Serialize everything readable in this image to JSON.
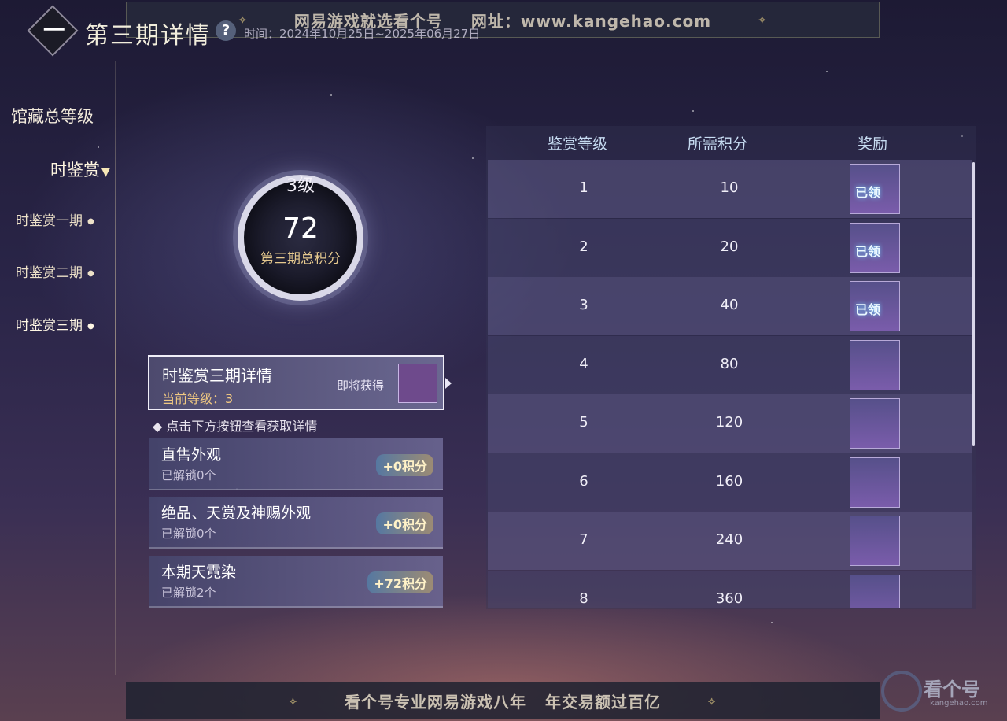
{
  "watermark": {
    "top_left": "网易游戏就选看个号",
    "top_right": "网址：www.kangehao.com",
    "bottom_left": "看个号专业网易游戏八年",
    "bottom_right": "年交易额过百亿"
  },
  "header": {
    "title": "第三期详情",
    "help_label": "?",
    "period": "时间：2024年10月25日~2025年06月27日"
  },
  "sidebar": {
    "total_level": "馆藏总等级",
    "main": "时鉴赏",
    "items": [
      {
        "label": "时鉴赏一期"
      },
      {
        "label": "时鉴赏二期"
      },
      {
        "label": "时鉴赏三期"
      }
    ]
  },
  "score": {
    "level": "3级",
    "points": "72",
    "label": "第三期总积分"
  },
  "detail_card": {
    "title": "时鉴赏三期详情",
    "current_level": "当前等级：3",
    "upcoming": "即将获得"
  },
  "hint": "◆ 点击下方按钮查看获取详情",
  "sources": [
    {
      "title": "直售外观",
      "unlocked": "已解锁0个",
      "points": "+0积分"
    },
    {
      "title": "绝品、天赏及神赐外观",
      "unlocked": "已解锁0个",
      "points": "+0积分"
    },
    {
      "title": "本期天霓染",
      "unlocked": "已解锁2个",
      "points": "+72积分"
    }
  ],
  "table": {
    "headers": [
      "鉴赏等级",
      "所需积分",
      "奖励"
    ],
    "rows": [
      {
        "level": "1",
        "points": "10",
        "claimed": "已领"
      },
      {
        "level": "2",
        "points": "20",
        "claimed": "已领"
      },
      {
        "level": "3",
        "points": "40",
        "claimed": "已领"
      },
      {
        "level": "4",
        "points": "80",
        "claimed": ""
      },
      {
        "level": "5",
        "points": "120",
        "claimed": ""
      },
      {
        "level": "6",
        "points": "160",
        "claimed": ""
      },
      {
        "level": "7",
        "points": "240",
        "claimed": ""
      },
      {
        "level": "8",
        "points": "360",
        "claimed": ""
      }
    ]
  },
  "logo": {
    "text": "看个号",
    "sub": "kangehao.com"
  }
}
